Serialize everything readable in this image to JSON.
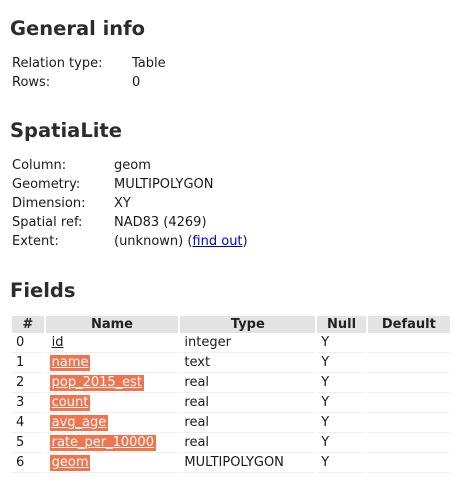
{
  "general": {
    "title": "General info",
    "rows": [
      {
        "key": "Relation type:",
        "value": "Table"
      },
      {
        "key": "Rows:",
        "value": "0"
      }
    ]
  },
  "spatialite": {
    "title": "SpatiaLite",
    "rows": [
      {
        "key": "Column:",
        "value": "geom"
      },
      {
        "key": "Geometry:",
        "value": "MULTIPOLYGON"
      },
      {
        "key": "Dimension:",
        "value": "XY"
      },
      {
        "key": "Spatial ref:",
        "value": "NAD83 (4269)"
      },
      {
        "key": "Extent:",
        "value": "(unknown) (",
        "link": "find out",
        "suffix": ")"
      }
    ]
  },
  "fields": {
    "title": "Fields",
    "headers": [
      "#",
      "Name",
      "Type",
      "Null",
      "Default"
    ],
    "highlight_color": "#f2744f",
    "rows": [
      {
        "num": "0",
        "name": "id",
        "type": "integer",
        "null": "Y",
        "default": ""
      },
      {
        "num": "1",
        "name": "name",
        "type": "text",
        "null": "Y",
        "default": ""
      },
      {
        "num": "2",
        "name": "pop_2015_est",
        "type": "real",
        "null": "Y",
        "default": ""
      },
      {
        "num": "3",
        "name": "count",
        "type": "real",
        "null": "Y",
        "default": ""
      },
      {
        "num": "4",
        "name": "avg_age",
        "type": "real",
        "null": "Y",
        "default": ""
      },
      {
        "num": "5",
        "name": "rate_per_10000",
        "type": "real",
        "null": "Y",
        "default": ""
      },
      {
        "num": "6",
        "name": "geom",
        "type": "MULTIPOLYGON",
        "null": "Y",
        "default": ""
      }
    ]
  }
}
